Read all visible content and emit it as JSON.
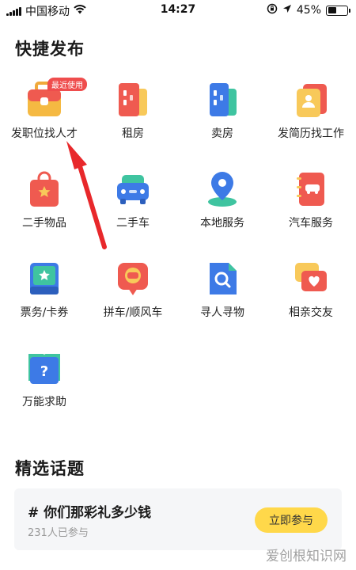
{
  "status_bar": {
    "carrier": "中国移动",
    "time": "14:27",
    "battery_percent": "45%",
    "battery_level": 0.45
  },
  "quick_post": {
    "title": "快捷发布",
    "items": [
      {
        "label": "发职位找人才",
        "icon": "briefcase-icon",
        "badge": "最近使用"
      },
      {
        "label": "租房",
        "icon": "rent-building-icon"
      },
      {
        "label": "卖房",
        "icon": "sell-building-icon"
      },
      {
        "label": "发简历找工作",
        "icon": "resume-icon"
      },
      {
        "label": "二手物品",
        "icon": "shopping-bag-icon"
      },
      {
        "label": "二手车",
        "icon": "used-car-icon"
      },
      {
        "label": "本地服务",
        "icon": "location-pin-icon"
      },
      {
        "label": "汽车服务",
        "icon": "car-service-book-icon"
      },
      {
        "label": "票务/卡券",
        "icon": "ticket-icon"
      },
      {
        "label": "拼车/顺风车",
        "icon": "carpool-pin-icon"
      },
      {
        "label": "寻人寻物",
        "icon": "search-document-icon"
      },
      {
        "label": "相亲交友",
        "icon": "heart-chat-icon"
      },
      {
        "label": "万能求助",
        "icon": "help-book-icon"
      }
    ]
  },
  "topics": {
    "title": "精选话题",
    "card": {
      "title": "# 你们那彩礼多少钱",
      "participants": "231人已参与",
      "join_label": "立即参与"
    }
  },
  "watermark": "爱创根知识网",
  "colors": {
    "accent_red": "#ef4d4d",
    "button_yellow": "#ffd84a",
    "card_bg": "#f5f6f8"
  }
}
